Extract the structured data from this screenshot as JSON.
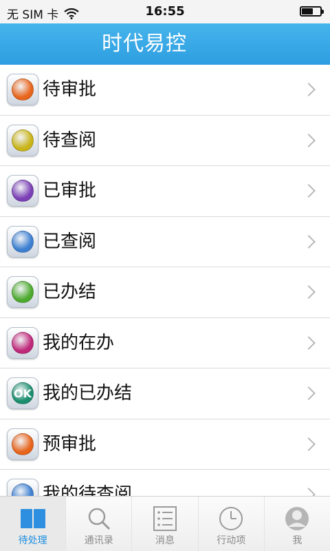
{
  "status_bar": {
    "carrier": "无 SIM 卡",
    "time": "16:55",
    "battery_level": 0.6
  },
  "header": {
    "title": "时代易控"
  },
  "menu": {
    "items": [
      {
        "label": "待审批",
        "icon": "approval-pending-icon",
        "color": "#e8641b"
      },
      {
        "label": "待查阅",
        "icon": "review-pending-icon",
        "color": "#c9b41a"
      },
      {
        "label": "已审批",
        "icon": "approved-icon",
        "color": "#7b3fb6"
      },
      {
        "label": "已查阅",
        "icon": "reviewed-icon",
        "color": "#3d7fd1"
      },
      {
        "label": "已办结",
        "icon": "completed-icon",
        "color": "#4daa2e"
      },
      {
        "label": "我的在办",
        "icon": "my-in-progress-icon",
        "color": "#c0287a"
      },
      {
        "label": "我的已办结",
        "icon": "my-completed-icon",
        "color": "#1b8e6e",
        "badge": "OK"
      },
      {
        "label": "预审批",
        "icon": "pre-approval-icon",
        "color": "#e8641b"
      },
      {
        "label": "我的待查阅",
        "icon": "my-review-pending-icon",
        "color": "#3d7fd1"
      }
    ]
  },
  "tabbar": {
    "tabs": [
      {
        "label": "待处理",
        "icon": "book-icon",
        "active": true
      },
      {
        "label": "通讯录",
        "icon": "search-icon",
        "active": false
      },
      {
        "label": "消息",
        "icon": "list-icon",
        "active": false
      },
      {
        "label": "行动项",
        "icon": "clock-icon",
        "active": false
      },
      {
        "label": "我",
        "icon": "user-icon",
        "active": false
      }
    ]
  },
  "colors": {
    "header": "#2d9ee0",
    "active_tab": "#1d8fe0"
  }
}
